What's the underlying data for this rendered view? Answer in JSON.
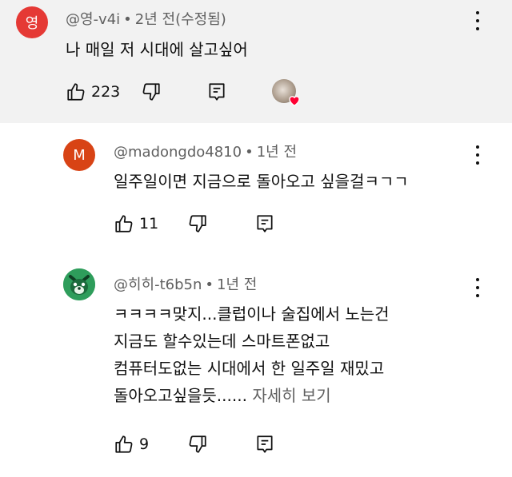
{
  "comments": [
    {
      "avatar_letter": "영",
      "avatar_color": "#e53935",
      "handle": "@영-v4i",
      "time": "2년 전(수정됨)",
      "lines": [
        "나 매일 저 시대에 살고싶어"
      ],
      "likes": "223",
      "creator_heart": true
    },
    {
      "avatar_letter": "M",
      "avatar_color": "#d84315",
      "handle": "@madongdo4810",
      "time": "1년 전",
      "lines": [
        "일주일이면 지금으로 돌아오고 싶을걸ㅋㄱㄱ"
      ],
      "likes": "11"
    },
    {
      "avatar_color": "#2e9d5b",
      "handle": "@히히-t6b5n",
      "time": "1년 전",
      "lines": [
        "ㅋㅋㅋㅋ맞지...클럽이나 술집에서 노는건",
        "지금도 할수있는데 스마트폰없고",
        "컴퓨터도없는 시대에서 한 일주일 재밌고",
        "돌아오고싶을듯......"
      ],
      "more_label": "자세히 보기",
      "likes": "9"
    }
  ],
  "icons": {
    "like": "thumbs-up-icon",
    "dislike": "thumbs-down-icon",
    "reply": "reply-icon",
    "menu": "more-vert-icon",
    "heart": "heart-icon"
  }
}
